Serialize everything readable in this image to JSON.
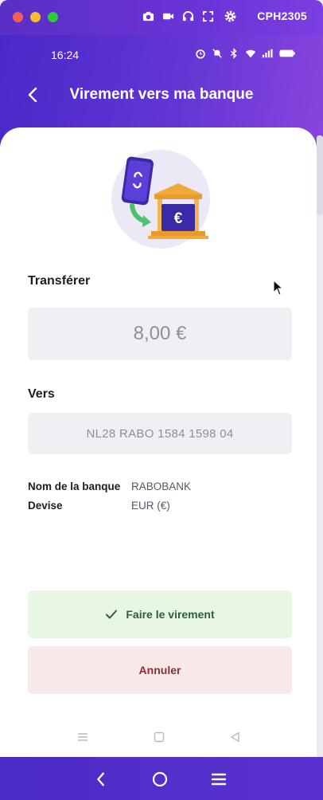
{
  "window": {
    "device_name": "CPH2305",
    "icons": [
      "camera-icon",
      "video-icon",
      "headphones-icon",
      "fullscreen-icon",
      "gear-icon"
    ]
  },
  "status_bar": {
    "time": "16:24",
    "icons": [
      "alarm-icon",
      "mute-icon",
      "bluetooth-icon",
      "wifi-icon",
      "signal-icon",
      "battery-icon"
    ]
  },
  "header": {
    "title": "Virement vers ma banque"
  },
  "transfer": {
    "label": "Transférer",
    "amount": "8,00 €"
  },
  "destination": {
    "label": "Vers",
    "iban": "NL28 RABO 1584 1598 04"
  },
  "bank_info": [
    {
      "key": "Nom de la banque",
      "value": "RABOBANK"
    },
    {
      "key": "Devise",
      "value": "EUR (€)"
    }
  ],
  "actions": {
    "confirm_label": "Faire le virement",
    "cancel_label": "Annuler"
  },
  "colors": {
    "brand_purple": "#5a31cf",
    "confirm_bg": "#e8f6e4",
    "cancel_bg": "#f8e8e8",
    "field_bg": "#eff0f4"
  }
}
